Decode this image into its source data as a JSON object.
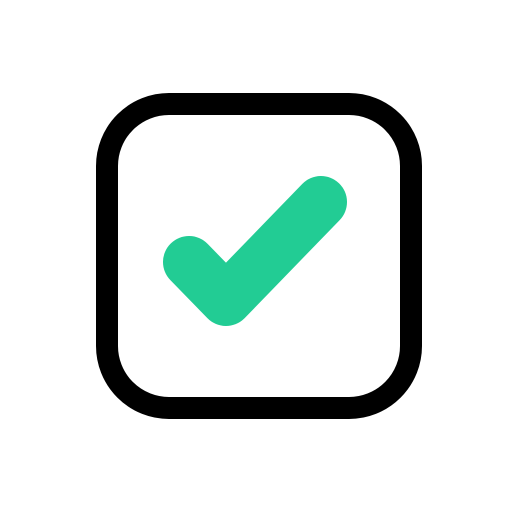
{
  "icon": {
    "name": "checked-checkbox-icon",
    "state": "checked",
    "colors": {
      "frame": "#000000",
      "checkmark": "#22CC94",
      "background": "#ffffff"
    }
  }
}
